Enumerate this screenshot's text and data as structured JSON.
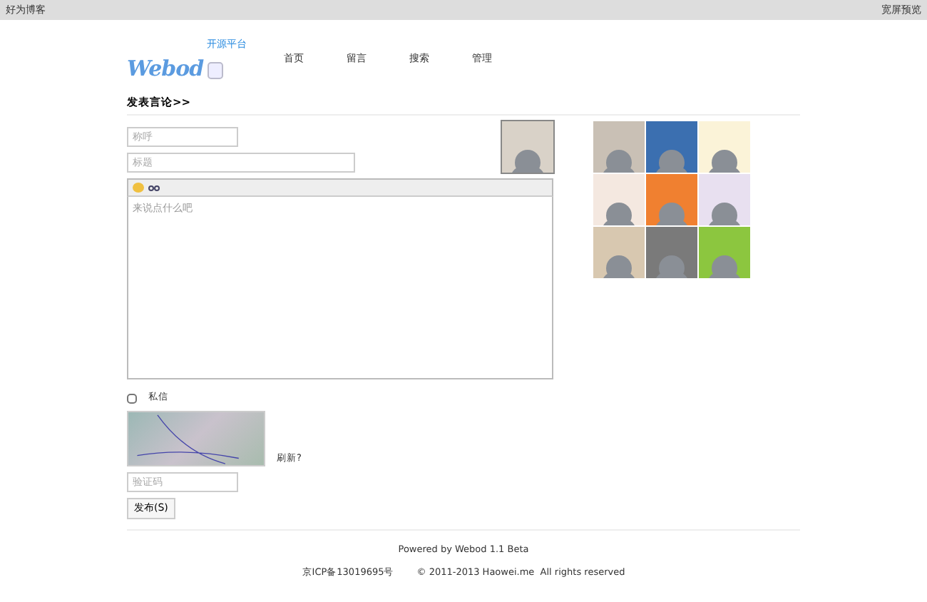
{
  "top_bar": {
    "site_name": "好为博客",
    "wide_view_link": "宽屏预览"
  },
  "logo": {
    "text": "Webod",
    "tagline": "开源平台"
  },
  "nav": [
    {
      "label": "首页"
    },
    {
      "label": "留言"
    },
    {
      "label": "搜索"
    },
    {
      "label": "管理"
    }
  ],
  "section_title": "发表言论>>",
  "form": {
    "nickname": {
      "placeholder": "称呼"
    },
    "title": {
      "placeholder": "标题"
    },
    "message": {
      "placeholder": "来说点什么吧"
    },
    "private": {
      "label": "私信",
      "checked": false
    },
    "refresh_link": "刷新?",
    "captcha": {
      "placeholder": "验证码"
    },
    "submit": "发布(S)"
  },
  "avatars": [
    {
      "selected": true
    },
    {
      "selected": false
    },
    {
      "selected": false
    },
    {
      "selected": false
    },
    {
      "selected": false
    },
    {
      "selected": false
    },
    {
      "selected": false
    },
    {
      "selected": false
    },
    {
      "selected": false
    },
    {
      "selected": false
    }
  ],
  "footer": {
    "powered": "Powered by Webod 1.1 Beta",
    "icp": "京ICP备13019695号",
    "copyright": "© 2011-2013 Haowei.me  All rights reserved"
  }
}
